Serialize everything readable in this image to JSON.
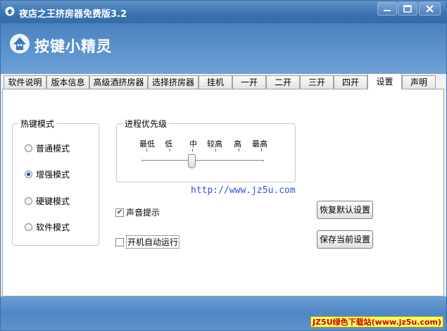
{
  "window": {
    "title": "夜店之王挤房器免费版3.2"
  },
  "banner": {
    "logo_text": "按键小精灵"
  },
  "tabs": [
    {
      "label": "软件说明"
    },
    {
      "label": "版本信息"
    },
    {
      "label": "高级酒挤房器"
    },
    {
      "label": "选择挤房器"
    },
    {
      "label": "挂机"
    },
    {
      "label": "一开"
    },
    {
      "label": "二开"
    },
    {
      "label": "三开"
    },
    {
      "label": "四开"
    },
    {
      "label": "设置"
    },
    {
      "label": "声明"
    }
  ],
  "active_tab": "设置",
  "hotkey_group": {
    "title": "热键模式",
    "options": [
      {
        "label": "普通模式",
        "selected": false
      },
      {
        "label": "增强模式",
        "selected": true
      },
      {
        "label": "硬键模式",
        "selected": false
      },
      {
        "label": "软件模式",
        "selected": false
      }
    ]
  },
  "priority_group": {
    "title": "进程优先级",
    "levels": [
      "最低",
      "低",
      "中",
      "较高",
      "高",
      "最高"
    ],
    "selected_level": "中"
  },
  "link": {
    "text": "http://www.jz5u.com"
  },
  "options": {
    "sound": {
      "label": "声音提示",
      "checked": true
    },
    "autostart": {
      "label": "开机自动运行",
      "checked": false
    }
  },
  "buttons": {
    "restore_defaults": "恢复默认设置",
    "save_current": "保存当前设置"
  },
  "watermark": {
    "text": "JZ5U绿色下载站(www.jz5u.com)"
  }
}
